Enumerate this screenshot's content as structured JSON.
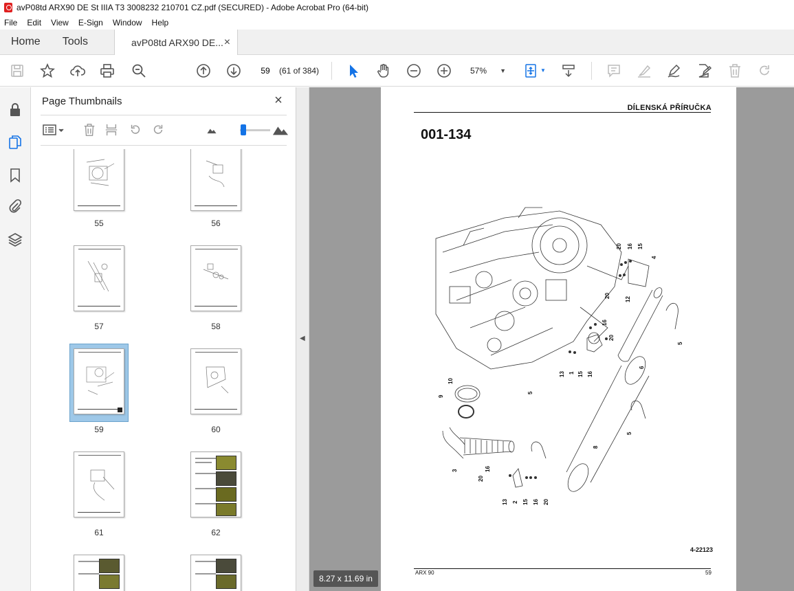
{
  "window": {
    "title": "avP08td ARX90 DE St IIIA T3 3008232 210701 CZ.pdf (SECURED) - Adobe Acrobat Pro (64-bit)"
  },
  "menu": [
    "File",
    "Edit",
    "View",
    "E-Sign",
    "Window",
    "Help"
  ],
  "tabs": {
    "home": "Home",
    "tools": "Tools",
    "document": "avP08td ARX90 DE...",
    "close": "×"
  },
  "toolbar": {
    "page_number": "59",
    "page_count": "(61 of 384)",
    "zoom": "57%"
  },
  "thumbnails_panel": {
    "title": "Page Thumbnails",
    "close": "×",
    "pages": [
      {
        "label": "55",
        "kind": "drawing"
      },
      {
        "label": "56",
        "kind": "drawing"
      },
      {
        "label": "57",
        "kind": "drawing"
      },
      {
        "label": "58",
        "kind": "drawing"
      },
      {
        "label": "59",
        "kind": "drawing",
        "selected": true
      },
      {
        "label": "60",
        "kind": "drawing"
      },
      {
        "label": "61",
        "kind": "drawing"
      },
      {
        "label": "62",
        "kind": "photo"
      }
    ]
  },
  "document_page": {
    "header": "DÍLENSKÁ PŘÍRUČKA",
    "heading": "001-134",
    "figure_code": "4-22123",
    "footer_left": "ARX 90",
    "footer_right": "59",
    "callouts": [
      "20",
      "16",
      "15",
      "4",
      "20",
      "12",
      "16",
      "20",
      "5",
      "13",
      "1",
      "15",
      "16",
      "6",
      "10",
      "9",
      "5",
      "8",
      "5",
      "3",
      "16",
      "20",
      "13",
      "2",
      "15",
      "16",
      "20"
    ]
  },
  "page_size": "8.27 x 11.69 in",
  "accent_color": "#1473e6"
}
